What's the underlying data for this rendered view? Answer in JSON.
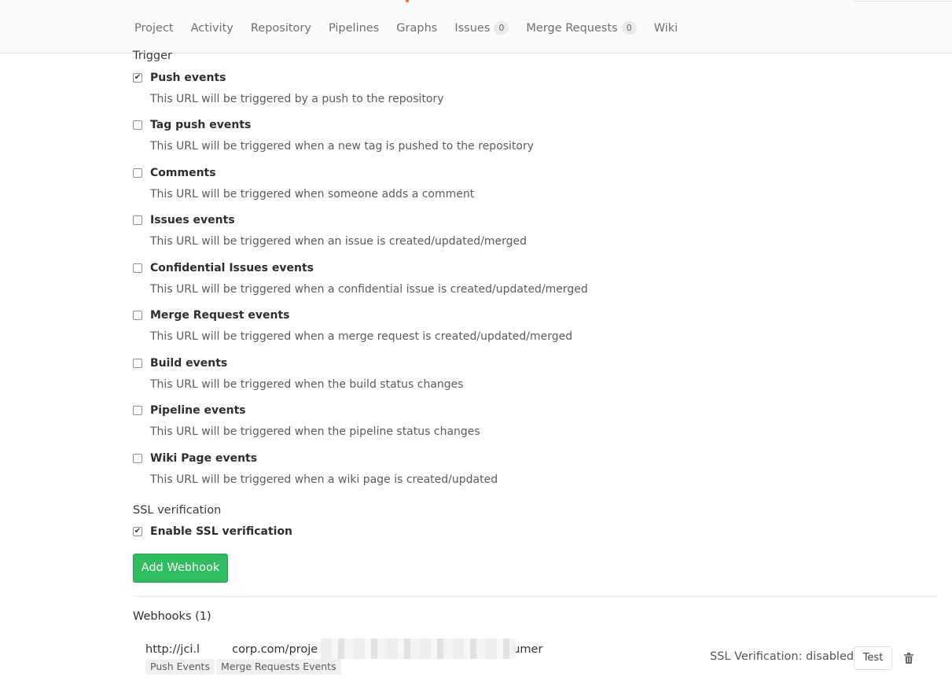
{
  "nav": {
    "tabs": [
      {
        "label": "Project"
      },
      {
        "label": "Activity"
      },
      {
        "label": "Repository"
      },
      {
        "label": "Pipelines"
      },
      {
        "label": "Graphs"
      },
      {
        "label": "Issues",
        "count": "0"
      },
      {
        "label": "Merge Requests",
        "count": "0"
      },
      {
        "label": "Wiki"
      }
    ]
  },
  "trigger": {
    "label": "Trigger",
    "events": [
      {
        "title": "Push events",
        "desc": "This URL will be triggered by a push to the repository",
        "checked": true
      },
      {
        "title": "Tag push events",
        "desc": "This URL will be triggered when a new tag is pushed to the repository",
        "checked": false
      },
      {
        "title": "Comments",
        "desc": "This URL will be triggered when someone adds a comment",
        "checked": false
      },
      {
        "title": "Issues events",
        "desc": "This URL will be triggered when an issue is created/updated/merged",
        "checked": false
      },
      {
        "title": "Confidential Issues events",
        "desc": "This URL will be triggered when a confidential issue is created/updated/merged",
        "checked": false
      },
      {
        "title": "Merge Request events",
        "desc": "This URL will be triggered when a merge request is created/updated/merged",
        "checked": false
      },
      {
        "title": "Build events",
        "desc": "This URL will be triggered when the build status changes",
        "checked": false
      },
      {
        "title": "Pipeline events",
        "desc": "This URL will be triggered when the pipeline status changes",
        "checked": false
      },
      {
        "title": "Wiki Page events",
        "desc": "This URL will be triggered when a wiki page is created/updated",
        "checked": false
      }
    ]
  },
  "ssl": {
    "label": "SSL verification",
    "option": "Enable SSL verification",
    "checked": true
  },
  "add_button": "Add Webhook",
  "webhooks": {
    "title": "Webhooks (1)",
    "items": [
      {
        "url_start": "http://jci.l",
        "url_middle": "corp.com/proje",
        "url_end": "umer",
        "tags": [
          "Push Events",
          "Merge Requests Events"
        ],
        "ssl_status": "SSL Verification: disabled",
        "test_label": "Test"
      }
    ]
  },
  "colors": {
    "accent_green": "#2fbd5f",
    "brand_orange": "#fc6d26"
  }
}
